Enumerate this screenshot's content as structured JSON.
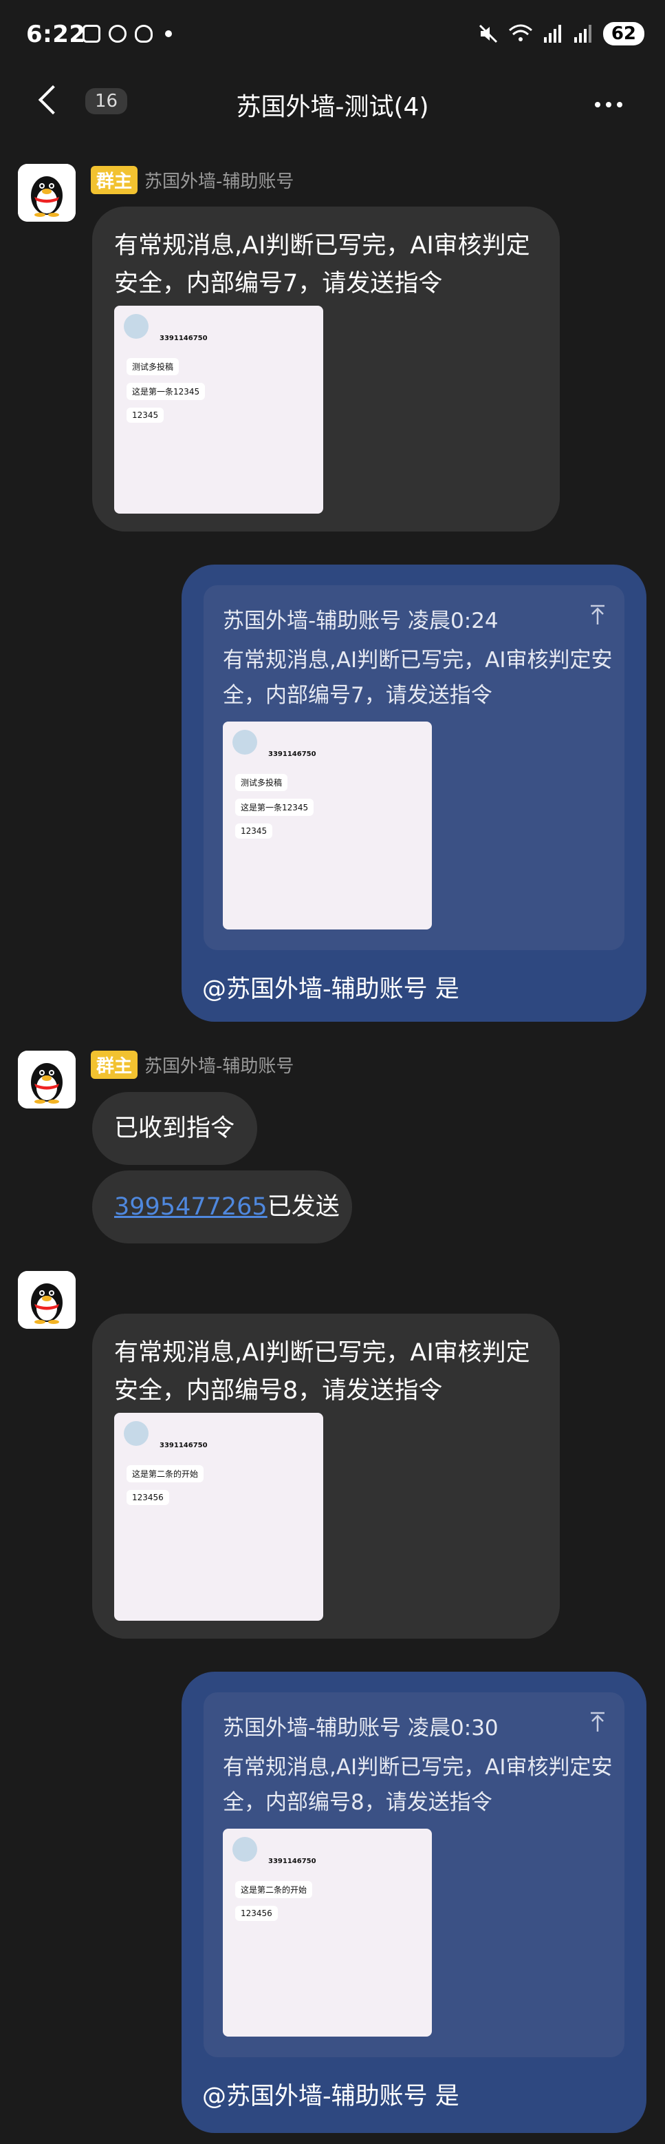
{
  "status_bar": {
    "time": "6:22",
    "battery": "62"
  },
  "nav": {
    "unread_count": "16",
    "title": "苏国外墙-测试(4)"
  },
  "messages": [
    {
      "role_badge": "群主",
      "sender": "苏国外墙-辅助账号",
      "text": "有常规消息,AI判断已写完，AI审核判定安全，内部编号7，请发送指令",
      "image": {
        "user_id": "3391146750",
        "lines": [
          "测试多投稿",
          "这是第一条12345",
          "12345"
        ]
      }
    },
    {
      "quote": {
        "sender": "苏国外墙-辅助账号",
        "time": "凌晨0:24",
        "text": "有常规消息,AI判断已写完，AI审核判定安全，内部编号7，请发送指令",
        "image": {
          "user_id": "3391146750",
          "lines": [
            "测试多投稿",
            "这是第一条12345",
            "12345"
          ]
        }
      },
      "reply": "@苏国外墙-辅助账号 是"
    },
    {
      "role_badge": "群主",
      "sender": "苏国外墙-辅助账号",
      "text": "已收到指令",
      "text2_link": "3995477265",
      "text2_rest": "已发送"
    },
    {
      "text": "有常规消息,AI判断已写完，AI审核判定安全，内部编号8，请发送指令",
      "image": {
        "user_id": "3391146750",
        "lines": [
          "这是第二条的开始",
          "123456"
        ]
      }
    },
    {
      "quote": {
        "sender": "苏国外墙-辅助账号",
        "time": "凌晨0:30",
        "text": "有常规消息,AI判断已写完，AI审核判定安全，内部编号8，请发送指令",
        "image": {
          "user_id": "3391146750",
          "lines": [
            "这是第二条的开始",
            "123456"
          ]
        }
      },
      "reply": "@苏国外墙-辅助账号 是"
    }
  ]
}
